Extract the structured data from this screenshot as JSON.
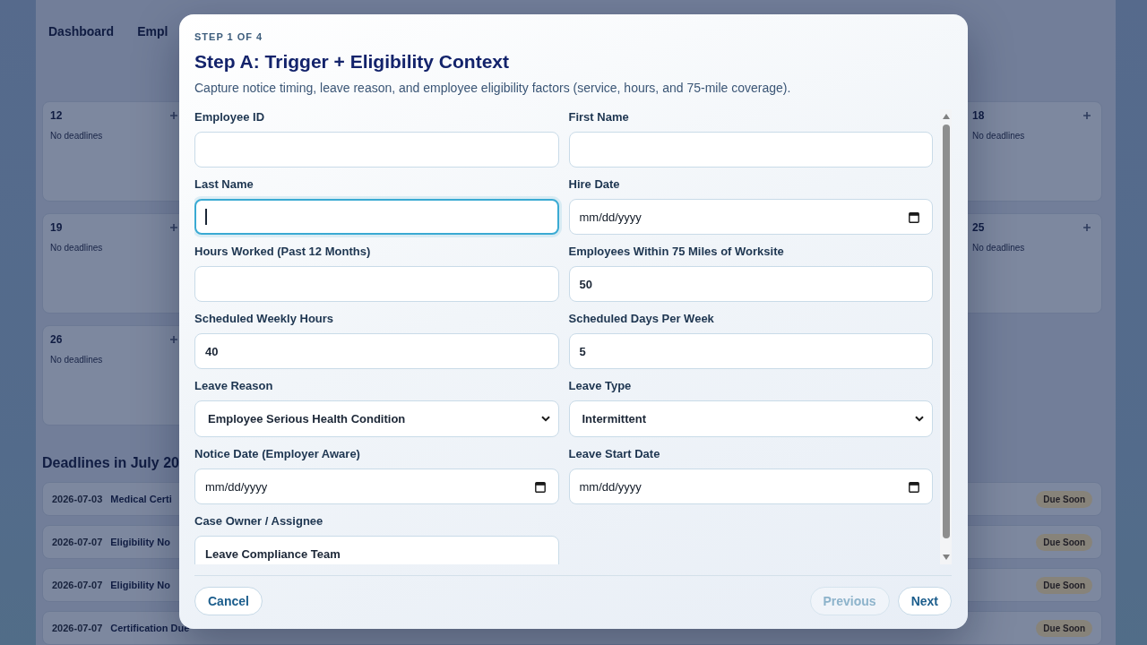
{
  "backdrop": {
    "nav": [
      {
        "label": "Dashboard"
      },
      {
        "label": "Empl"
      }
    ],
    "calendar_weeks": [
      {
        "cells": [
          {
            "day": "12",
            "note": "No deadlines"
          },
          {
            "day": "18",
            "note": "No deadlines"
          }
        ]
      },
      {
        "cells": [
          {
            "day": "19",
            "note": "No deadlines"
          },
          {
            "day": "25",
            "note": "No deadlines"
          }
        ]
      },
      {
        "cells": [
          {
            "day": "26",
            "note": "No deadlines"
          }
        ]
      }
    ],
    "deadlines": {
      "title": "Deadlines in July 20",
      "rows": [
        {
          "date": "2026-07-03",
          "title": "Medical Certi",
          "badge": "Due Soon"
        },
        {
          "date": "2026-07-07",
          "title": "Eligibility No",
          "badge": "Due Soon"
        },
        {
          "date": "2026-07-07",
          "title": "Eligibility No",
          "badge": "Due Soon"
        },
        {
          "date": "2026-07-07",
          "title": "Certification Due",
          "badge": "Due Soon"
        }
      ]
    }
  },
  "dialog": {
    "step": "STEP 1 OF 4",
    "title": "Step A: Trigger + Eligibility Context",
    "description": "Capture notice timing, leave reason, and employee eligibility factors (service, hours, and 75-mile coverage).",
    "fields": [
      {
        "label": "Employee ID",
        "kind": "text",
        "focused": false
      },
      {
        "label": "First Name",
        "kind": "text",
        "focused": false
      },
      {
        "label": "Last Name",
        "kind": "text",
        "focused": true
      },
      {
        "label": "Hire Date",
        "kind": "date",
        "placeholder": "mm/dd/yyyy",
        "focused": false
      },
      {
        "label": "Hours Worked (Past 12 Months)",
        "kind": "text",
        "focused": false
      },
      {
        "label": "Employees Within 75 Miles of Worksite",
        "kind": "text",
        "value": "50",
        "focused": false
      },
      {
        "label": "Scheduled Weekly Hours",
        "kind": "text",
        "value": "40",
        "focused": false
      },
      {
        "label": "Scheduled Days Per Week",
        "kind": "text",
        "value": "5",
        "focused": false
      },
      {
        "label": "Leave Reason",
        "kind": "select",
        "value": "Employee Serious Health Condition",
        "focused": false
      },
      {
        "label": "Leave Type",
        "kind": "select",
        "value": "Intermittent",
        "focused": false
      },
      {
        "label": "Notice Date (Employer Aware)",
        "kind": "date",
        "placeholder": "mm/dd/yyyy",
        "focused": false
      },
      {
        "label": "Leave Start Date",
        "kind": "date",
        "placeholder": "mm/dd/yyyy",
        "focused": false
      },
      {
        "label": "Case Owner / Assignee",
        "kind": "text",
        "value": "Leave Compliance Team",
        "focused": false
      }
    ],
    "footer": {
      "left_buttons": [
        {
          "label": "Cancel",
          "disabled": false
        }
      ],
      "right_buttons": [
        {
          "label": "Previous",
          "disabled": true
        },
        {
          "label": "Next",
          "disabled": false
        }
      ]
    }
  }
}
